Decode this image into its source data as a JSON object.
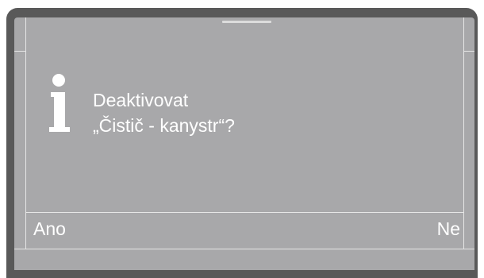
{
  "dialog": {
    "icon": "info-icon",
    "message_line1": "Deaktivovat",
    "message_line2": "„Čistič - kanystr“?"
  },
  "softkeys": {
    "left_label": "Ano",
    "right_label": "Ne"
  },
  "colors": {
    "bezel": "#595959",
    "screen_background": "#a8a8aa",
    "text": "#ffffff",
    "divider": "#e6e6e6"
  }
}
